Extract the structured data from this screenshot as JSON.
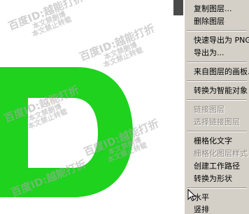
{
  "colors": {
    "menu_bg": "#d4d0c8",
    "menu_text": "#000000",
    "menu_disabled": "#8e8a82",
    "green_shape": "#1ed21e",
    "watermark": "#aaaaaa"
  },
  "watermark": {
    "line1": "百度ID:越能打折",
    "line2": "本文禁删博",
    "line3": "本文禁止转载"
  },
  "context_menu": {
    "items": [
      {
        "label": "复制图层...",
        "enabled": true
      },
      {
        "label": "删除图层",
        "enabled": true
      },
      {
        "label": "快速导出为 PNG",
        "enabled": true
      },
      {
        "label": "导出为...",
        "enabled": true
      },
      {
        "label": "来自图层的画板...",
        "enabled": true
      },
      {
        "label": "转换为智能对象",
        "enabled": true
      },
      {
        "label": "链接图层",
        "enabled": false
      },
      {
        "label": "选择链接图层",
        "enabled": false
      },
      {
        "label": "栅格化文字",
        "enabled": true
      },
      {
        "label": "栅格化图层样式",
        "enabled": false
      },
      {
        "label": "创建工作路径",
        "enabled": true
      },
      {
        "label": "转换为形状",
        "enabled": true
      },
      {
        "label": "水平",
        "enabled": true
      },
      {
        "label": "竖排",
        "enabled": true
      }
    ]
  },
  "icons": {
    "cursor": "arrow-cursor-icon"
  }
}
